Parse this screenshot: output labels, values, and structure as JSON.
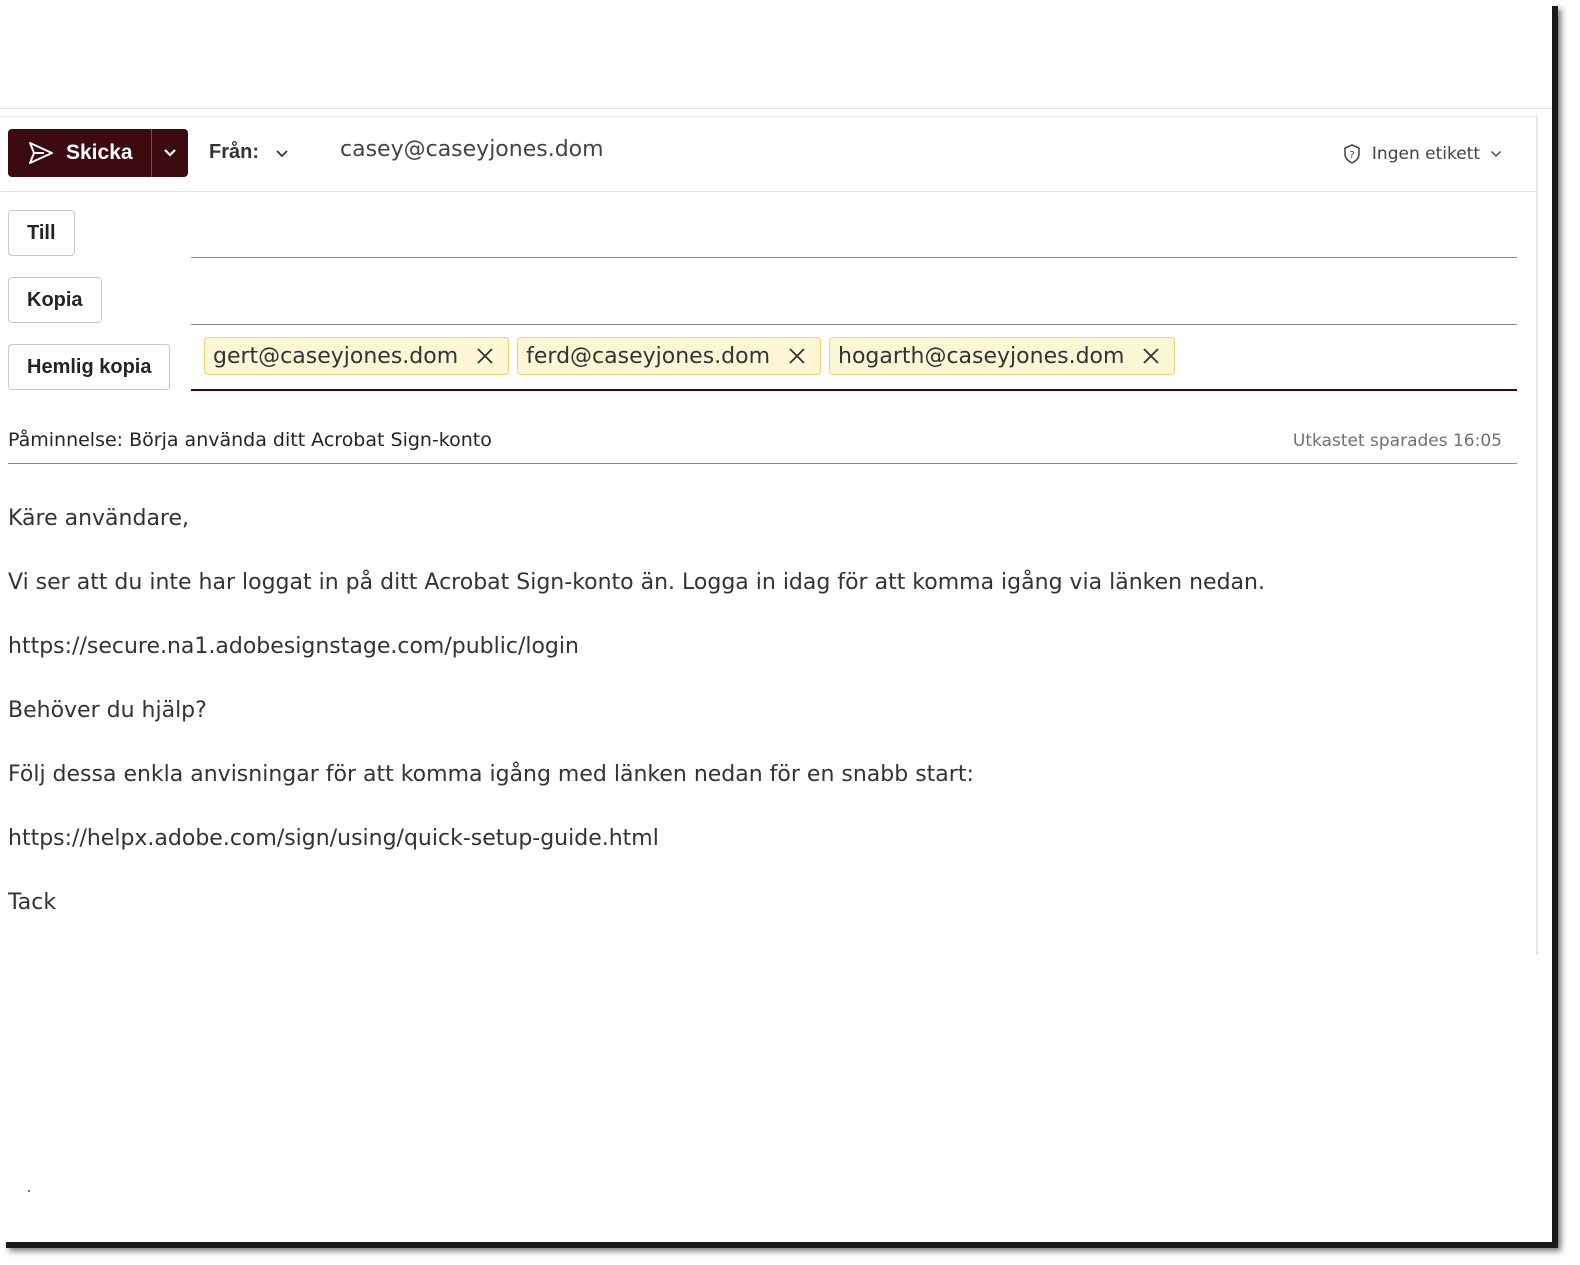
{
  "toolbar": {
    "send_label": "Skicka",
    "from_label": "Från:",
    "from_value": "casey@caseyjones.dom",
    "sensitivity_label": "Ingen etikett"
  },
  "recipients": {
    "to_label": "Till",
    "cc_label": "Kopia",
    "bcc_label": "Hemlig kopia",
    "bcc_chips": [
      "gert@caseyjones.dom",
      "ferd@caseyjones.dom",
      "hogarth@caseyjones.dom"
    ]
  },
  "subject": {
    "value": "Påminnelse: Börja använda ditt Acrobat Sign-konto",
    "draft_status": "Utkastet sparades 16:05"
  },
  "body": {
    "lines": [
      "Käre användare,",
      "Vi ser att du inte har loggat in på ditt Acrobat Sign-konto än. Logga in idag för att komma igång via länken nedan.",
      "https://secure.na1.adobesignstage.com/public/login",
      "Behöver du hjälp?",
      "Följ dessa enkla anvisningar för att komma igång med länken nedan för en snabb start:",
      "https://helpx.adobe.com/sign/using/quick-setup-guide.html",
      "Tack"
    ]
  },
  "colors": {
    "send_button": "#3b0a0f",
    "chip_background": "#fff6d6",
    "chip_border": "#f2d36b"
  }
}
